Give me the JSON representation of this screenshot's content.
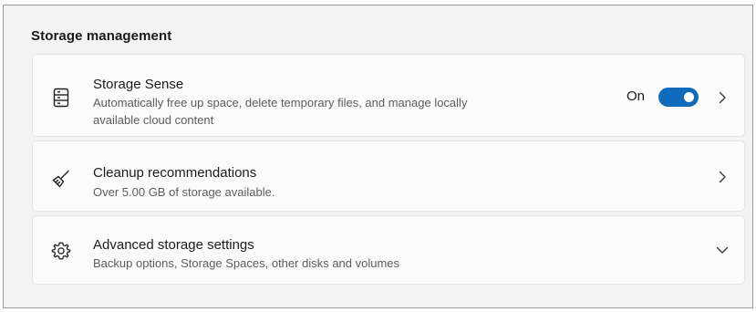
{
  "section": {
    "title": "Storage management"
  },
  "items": [
    {
      "title": "Storage Sense",
      "description": "Automatically free up space, delete temporary files, and manage locally available cloud content",
      "icon": "storage-drive-icon",
      "toggle": {
        "label": "On",
        "state": true
      },
      "action_icon": "chevron-right-icon"
    },
    {
      "title": "Cleanup recommendations",
      "description": "Over 5.00 GB of storage available.",
      "icon": "broom-icon",
      "action_icon": "chevron-right-icon"
    },
    {
      "title": "Advanced storage settings",
      "description": "Backup options, Storage Spaces, other disks and volumes",
      "icon": "gear-icon",
      "action_icon": "chevron-down-icon"
    }
  ],
  "colors": {
    "accent": "#0f6cbd",
    "background": "#f3f3f3",
    "card": "#fbfbfb"
  }
}
